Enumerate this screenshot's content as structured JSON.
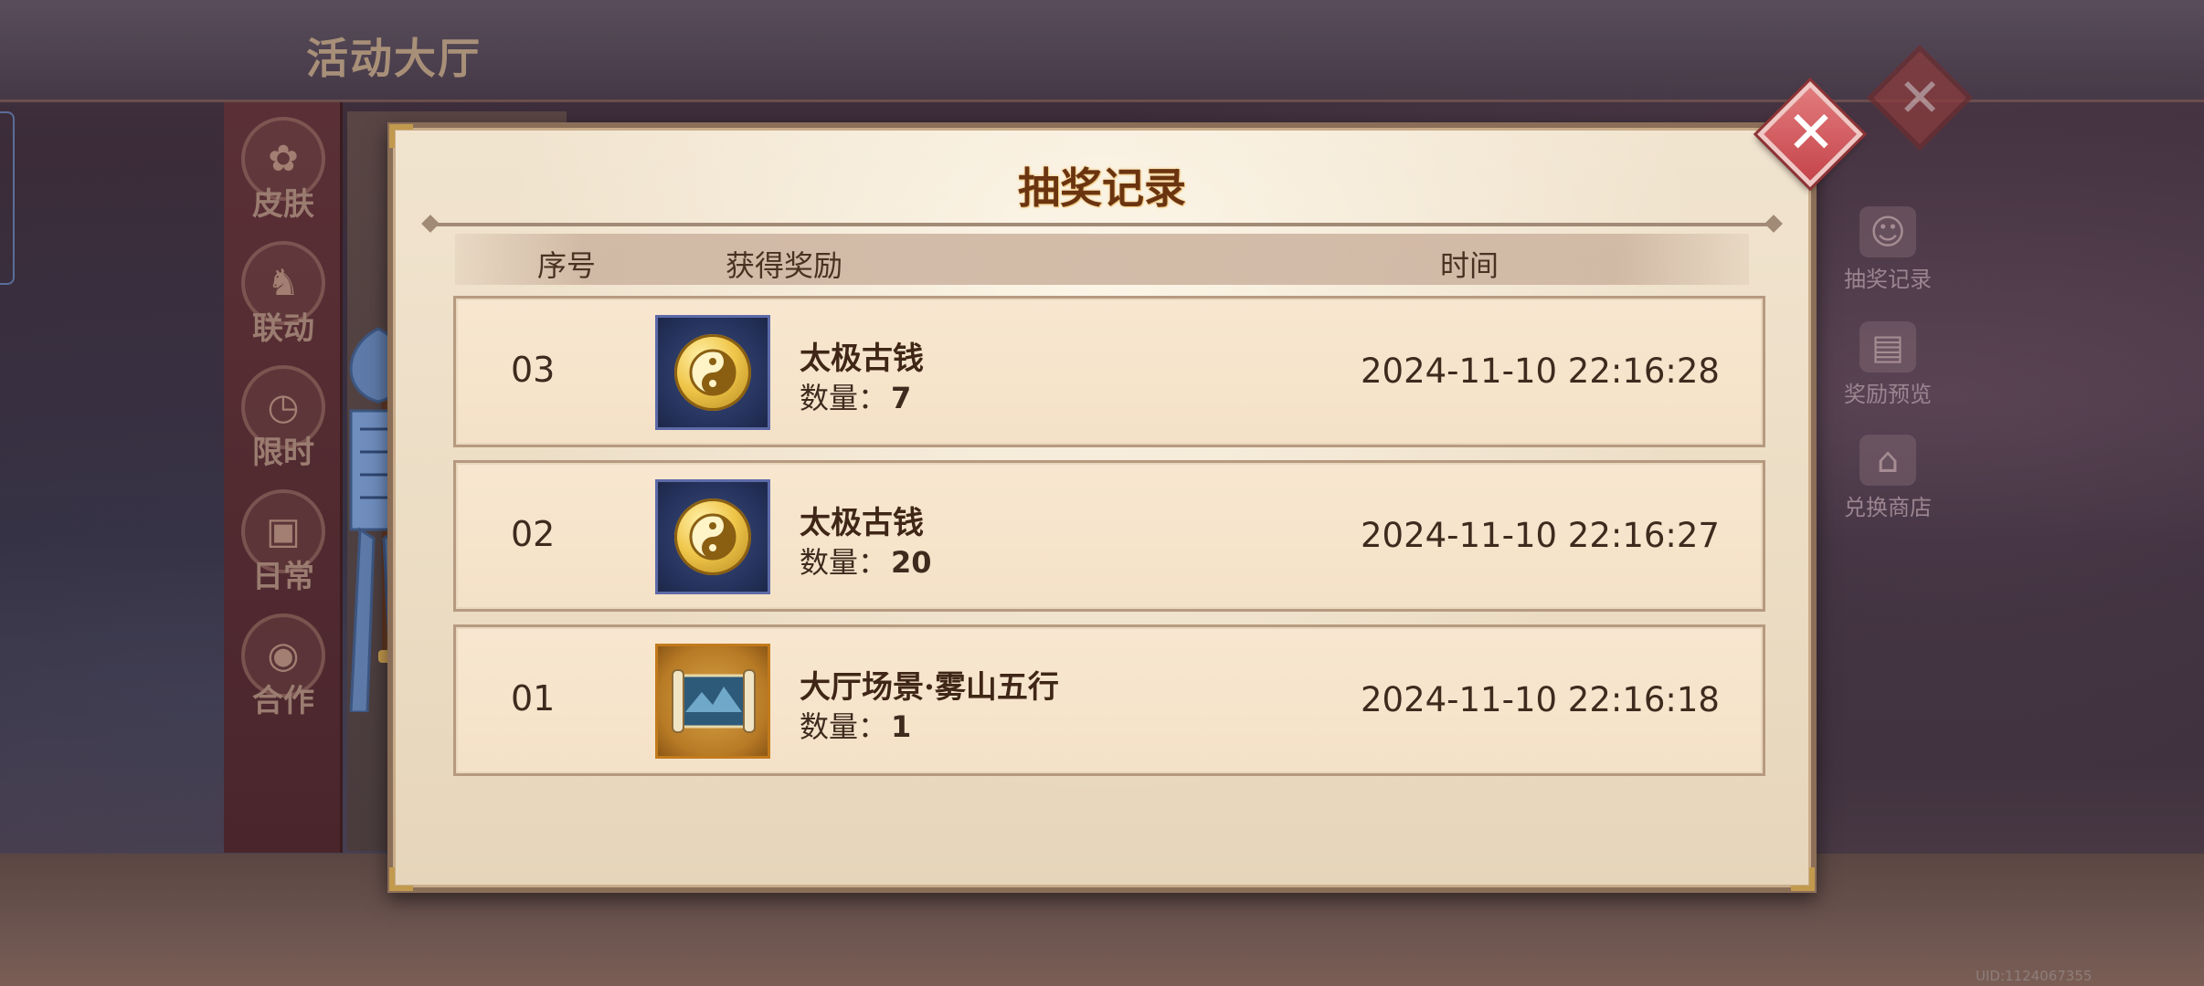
{
  "background": {
    "title": "活动大厅",
    "nav": [
      {
        "label": "皮肤",
        "icon": "ribbon-icon"
      },
      {
        "label": "联动",
        "icon": "horse-icon"
      },
      {
        "label": "限时",
        "icon": "clock-icon"
      },
      {
        "label": "日常",
        "icon": "gift-icon"
      },
      {
        "label": "合作",
        "icon": "coin-icon"
      }
    ],
    "right_menu": [
      {
        "label": "抽奖记录",
        "icon": "cat-icon"
      },
      {
        "label": "奖励预览",
        "icon": "gift-box-icon"
      },
      {
        "label": "兑换商店",
        "icon": "shop-icon"
      }
    ],
    "uid": "UID:1124067355"
  },
  "dialog": {
    "title": "抽奖记录",
    "close_label": "✕",
    "columns": {
      "seq": "序号",
      "reward": "获得奖励",
      "time": "时间"
    },
    "qty_label": "数量：",
    "rows": [
      {
        "seq": "03",
        "name": "太极古钱",
        "qty": "7",
        "time": "2024-11-10 22:16:28",
        "icon": "taiji-coin-icon"
      },
      {
        "seq": "02",
        "name": "太极古钱",
        "qty": "20",
        "time": "2024-11-10 22:16:27",
        "icon": "taiji-coin-icon"
      },
      {
        "seq": "01",
        "name": "大厅场景·雾山五行",
        "qty": "1",
        "time": "2024-11-10 22:16:18",
        "icon": "scene-scroll-icon"
      }
    ]
  },
  "colors": {
    "dialog_bg": "#f1e4cf",
    "row_bg": "#f8e7d0",
    "title_text": "#6b3410",
    "close_button": "#c5454b"
  }
}
